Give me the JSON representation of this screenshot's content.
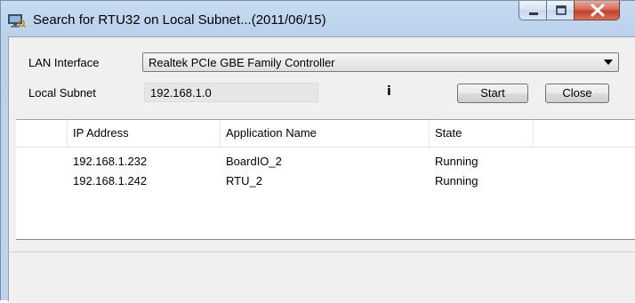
{
  "window": {
    "title": "Search for RTU32 on Local Subnet...(2011/06/15)",
    "icon": "network-search-icon",
    "caption_buttons": [
      "minimize-icon",
      "maximize-icon",
      "close-icon"
    ]
  },
  "form": {
    "lan_label": "LAN Interface",
    "lan_value": "Realtek PCIe GBE Family Controller",
    "subnet_label": "Local Subnet",
    "subnet_value": "192.168.1.0",
    "info_glyph": "i",
    "start_label": "Start",
    "close_label": "Close"
  },
  "table": {
    "columns": [
      "IP Address",
      "Application Name",
      "State"
    ],
    "rows": [
      {
        "ip": "192.168.1.232",
        "app": "BoardIO_2",
        "state": "Running"
      },
      {
        "ip": "192.168.1.242",
        "app": "RTU_2",
        "state": "Running"
      }
    ]
  },
  "colors": {
    "titlebar": "#b9d1ec",
    "client": "#f0f0f0",
    "close_button": "#c4402a"
  }
}
